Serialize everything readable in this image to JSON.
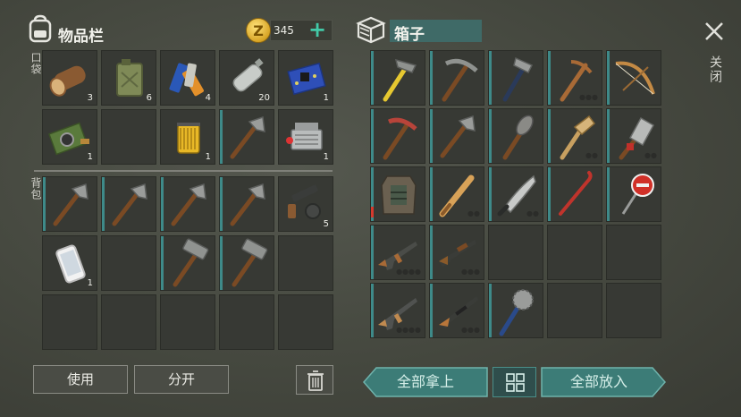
{
  "header": {
    "inventory_title": "物品栏",
    "coin_symbol": "Z",
    "coin_amount": "345",
    "add_symbol": "+",
    "box_title": "箱子",
    "close_label": "关闭"
  },
  "side_labels": {
    "pocket": "口袋",
    "backpack": "背包"
  },
  "pocket": [
    {
      "item": "log",
      "count": "3"
    },
    {
      "item": "jerrycan",
      "count": "6"
    },
    {
      "item": "batteries",
      "count": "4"
    },
    {
      "item": "plastic-bottle",
      "count": "20"
    },
    {
      "item": "circuit-board-blue",
      "count": "1"
    },
    {
      "item": "circuit-board-camera",
      "count": "1"
    },
    {
      "item": "",
      "count": ""
    },
    {
      "item": "oil-filter",
      "count": "1"
    },
    {
      "item": "hatchet",
      "count": ""
    },
    {
      "item": "engine-block",
      "count": "1"
    }
  ],
  "backpack": [
    {
      "item": "hatchet",
      "count": ""
    },
    {
      "item": "hatchet",
      "count": ""
    },
    {
      "item": "hatchet",
      "count": ""
    },
    {
      "item": "hatchet",
      "count": ""
    },
    {
      "item": "gun-parts",
      "count": "5"
    },
    {
      "item": "smartphone",
      "count": "1"
    },
    {
      "item": "",
      "count": ""
    },
    {
      "item": "sledgehammer",
      "count": ""
    },
    {
      "item": "sledgehammer",
      "count": ""
    },
    {
      "item": "",
      "count": ""
    },
    {
      "item": "",
      "count": ""
    },
    {
      "item": "",
      "count": ""
    },
    {
      "item": "",
      "count": ""
    },
    {
      "item": "",
      "count": ""
    },
    {
      "item": "",
      "count": ""
    }
  ],
  "box": [
    {
      "item": "hammer",
      "dots": ""
    },
    {
      "item": "pickaxe",
      "dots": ""
    },
    {
      "item": "hammer-steel",
      "dots": ""
    },
    {
      "item": "pickaxe-wood",
      "dots": "●●●"
    },
    {
      "item": "bow",
      "dots": ""
    },
    {
      "item": "pickaxe-red",
      "dots": ""
    },
    {
      "item": "hatchet",
      "dots": ""
    },
    {
      "item": "spiked-club",
      "dots": ""
    },
    {
      "item": "broken-paddle",
      "dots": "●●"
    },
    {
      "item": "cleaver",
      "dots": "●●"
    },
    {
      "item": "armor-vest",
      "dots": ""
    },
    {
      "item": "baseball-bat",
      "dots": "●●"
    },
    {
      "item": "machete",
      "dots": "●●"
    },
    {
      "item": "crowbar",
      "dots": ""
    },
    {
      "item": "stop-sign",
      "dots": ""
    },
    {
      "item": "assault-rifle",
      "dots": "●●●●"
    },
    {
      "item": "shotgun",
      "dots": "●●●"
    },
    {
      "item": "",
      "dots": ""
    },
    {
      "item": "",
      "dots": ""
    },
    {
      "item": "",
      "dots": ""
    },
    {
      "item": "assault-rifle-2",
      "dots": "●●●●"
    },
    {
      "item": "rifle",
      "dots": "●●●"
    },
    {
      "item": "saw-club",
      "dots": ""
    },
    {
      "item": "",
      "dots": ""
    },
    {
      "item": "",
      "dots": ""
    }
  ],
  "buttons": {
    "use": "使用",
    "split": "分开",
    "take_all": "全部拿上",
    "put_all": "全部放入"
  },
  "colors": {
    "accent_teal": "#3e8a89",
    "button_teal": "#3c7c77",
    "coin_gold": "#e0b030",
    "durability_red": "#d63a2e"
  }
}
